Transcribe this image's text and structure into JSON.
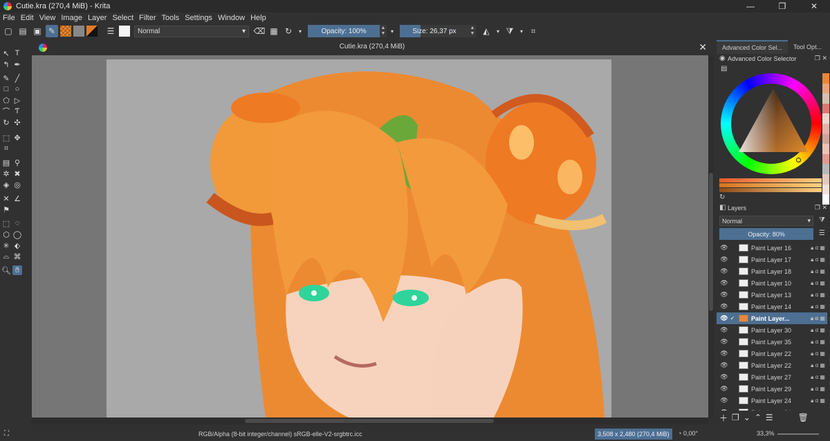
{
  "window": {
    "title": "Cutie.kra (270,4 MiB)  - Krita",
    "buttons": {
      "minimize": "—",
      "maximize": "❐",
      "close": "✕"
    }
  },
  "menu": [
    "File",
    "Edit",
    "View",
    "Image",
    "Layer",
    "Select",
    "Filter",
    "Tools",
    "Settings",
    "Window",
    "Help"
  ],
  "tool_options": {
    "blend_mode": "Normal",
    "opacity": "Opacity: 100%",
    "size": "Size: 26,37 px"
  },
  "document": {
    "tab_title": "Cutie.kra (270,4 MiB)",
    "close": "✕"
  },
  "dockers": {
    "tabs": [
      "Advanced Color Sel...",
      "Tool Opt..."
    ],
    "color_selector_title": "Advanced Color Selector",
    "palette_colors": [
      "#e8873a",
      "#e9a37a",
      "#d8bfae",
      "#d97a72",
      "#f0d6cc",
      "#e7b0a6",
      "#d2a399",
      "#f0c1b4",
      "#e29a90",
      "#b8b8b8",
      "#e5c8c0",
      "#f3e2dc",
      "#ffffff"
    ],
    "hue_bar_colors": [
      "#e85a2a",
      "#d4741f",
      "#8e4a18"
    ]
  },
  "layers": {
    "title": "Layers",
    "blend_mode": "Normal",
    "opacity": "Opacity:  80%",
    "items": [
      {
        "name": "Paint Layer 16",
        "selected": false
      },
      {
        "name": "Paint Layer 17",
        "selected": false
      },
      {
        "name": "Paint Layer 18",
        "selected": false
      },
      {
        "name": "Paint Layer 10",
        "selected": false
      },
      {
        "name": "Paint Layer 13",
        "selected": false
      },
      {
        "name": "Paint Layer 14",
        "selected": false
      },
      {
        "name": "Paint Layer...",
        "selected": true
      },
      {
        "name": "Paint Layer 30",
        "selected": false
      },
      {
        "name": "Paint Layer 35",
        "selected": false
      },
      {
        "name": "Paint Layer 22",
        "selected": false
      },
      {
        "name": "Paint Layer 22",
        "selected": false
      },
      {
        "name": "Paint Layer 27",
        "selected": false
      },
      {
        "name": "Paint Layer 29",
        "selected": false
      },
      {
        "name": "Paint Layer 24",
        "selected": false
      },
      {
        "name": "Paint Layer 34",
        "selected": false
      }
    ]
  },
  "status": {
    "colorspace": "RGB/Alpha (8-bit integer/channel)  sRGB-elle-V2-srgbtrc.icc",
    "dimensions": "3,508 x 2,480 (270,4 MiB)",
    "rotation": "0,00°",
    "zoom": "33,3%"
  }
}
